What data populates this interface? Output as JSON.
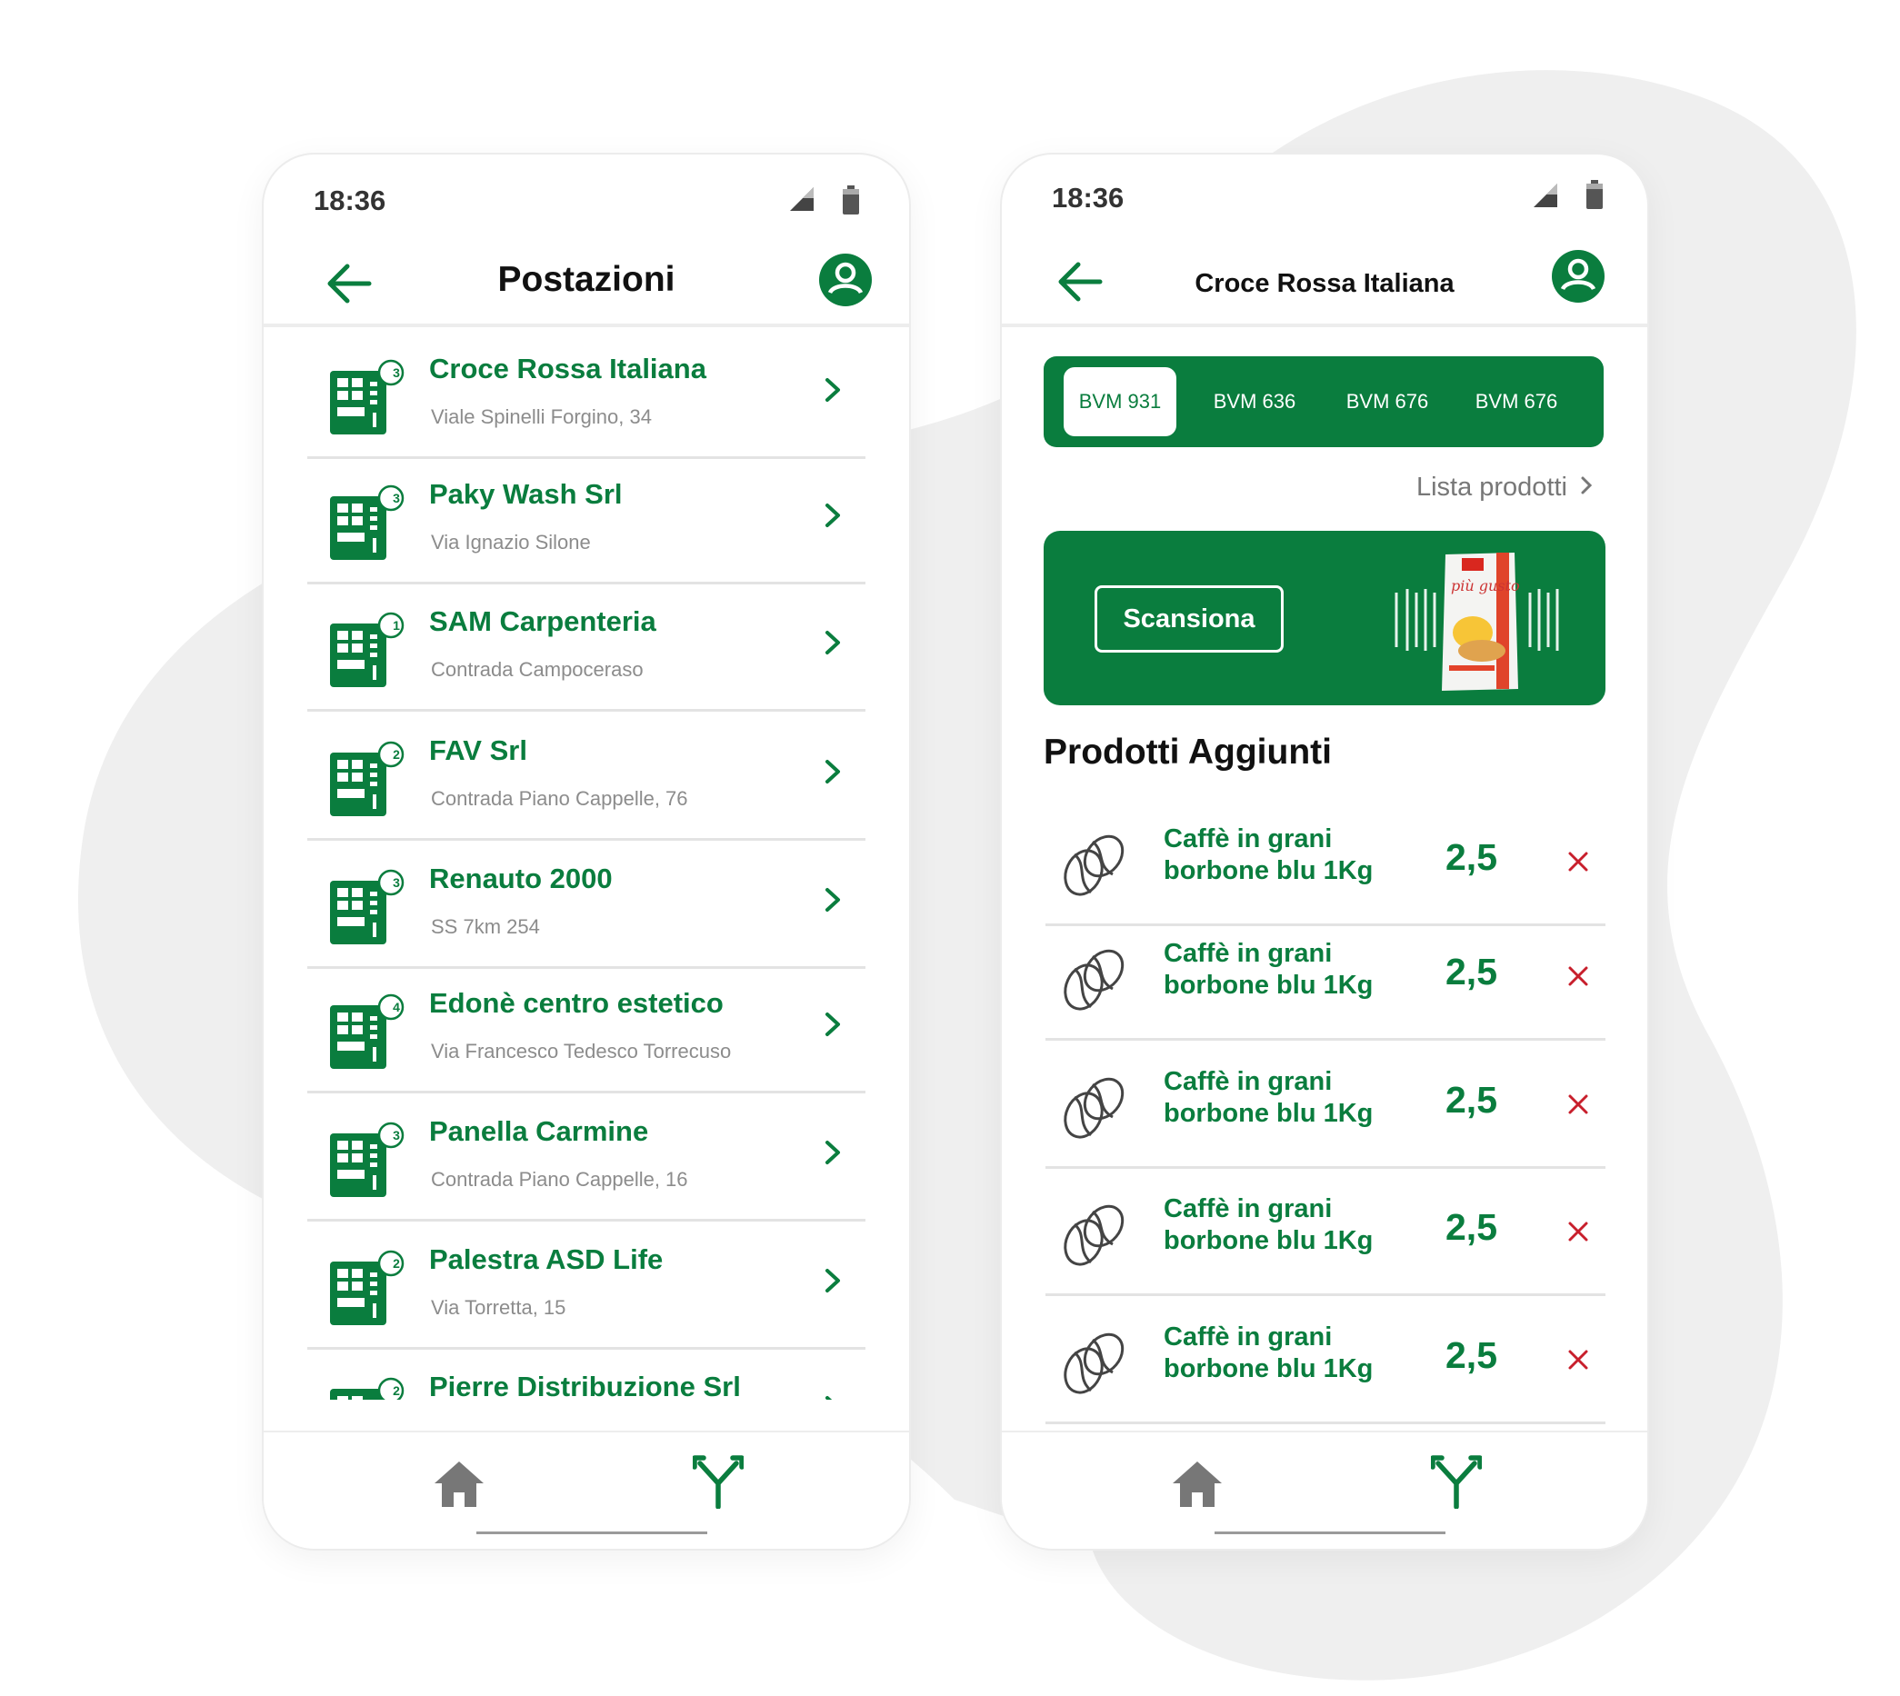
{
  "colors": {
    "brand_green": "#0a7d3e",
    "delete_red": "#c81f2c",
    "muted_gray": "#8c8c8c"
  },
  "left_screen": {
    "status_time": "18:36",
    "title": "Postazioni",
    "locations": [
      {
        "name": "Croce Rossa Italiana",
        "address": "Viale Spinelli Forgino, 34",
        "badge": "3"
      },
      {
        "name": "Paky Wash Srl",
        "address": "Via Ignazio Silone",
        "badge": "3"
      },
      {
        "name": "SAM Carpenteria",
        "address": "Contrada Campoceraso",
        "badge": "1"
      },
      {
        "name": "FAV Srl",
        "address": "Contrada Piano Cappelle, 76",
        "badge": "2"
      },
      {
        "name": "Renauto 2000",
        "address": "SS 7km 254",
        "badge": "3"
      },
      {
        "name": "Edonè centro estetico",
        "address": "Via Francesco Tedesco Torrecuso",
        "badge": "4"
      },
      {
        "name": "Panella Carmine",
        "address": "Contrada Piano Cappelle, 16",
        "badge": "3"
      },
      {
        "name": "Palestra ASD Life",
        "address": "Via Torretta, 15",
        "badge": "2"
      },
      {
        "name": "Pierre Distribuzione Srl",
        "address": "",
        "badge": "2"
      }
    ],
    "nav_icons": [
      "home-icon",
      "route-icon"
    ]
  },
  "right_screen": {
    "status_time": "18:36",
    "title": "Croce Rossa Italiana",
    "tabs": [
      "BVM 931",
      "BVM 636",
      "BVM 676",
      "BVM 676"
    ],
    "active_tab": 0,
    "product_list_link": "Lista prodotti",
    "scan_button": "Scansiona",
    "section_title": "Prodotti Aggiunti",
    "products": [
      {
        "name": "Caffè in grani borbone blu 1Kg",
        "qty": "2,5"
      },
      {
        "name": "Caffè in grani borbone blu 1Kg",
        "qty": "2,5"
      },
      {
        "name": "Caffè in grani borbone blu 1Kg",
        "qty": "2,5"
      },
      {
        "name": "Caffè in grani borbone blu 1Kg",
        "qty": "2,5"
      },
      {
        "name": "Caffè in grani borbone blu 1Kg",
        "qty": "2,5"
      }
    ],
    "banner_product_text": "più gusto",
    "nav_icons": [
      "home-icon",
      "route-icon"
    ]
  }
}
